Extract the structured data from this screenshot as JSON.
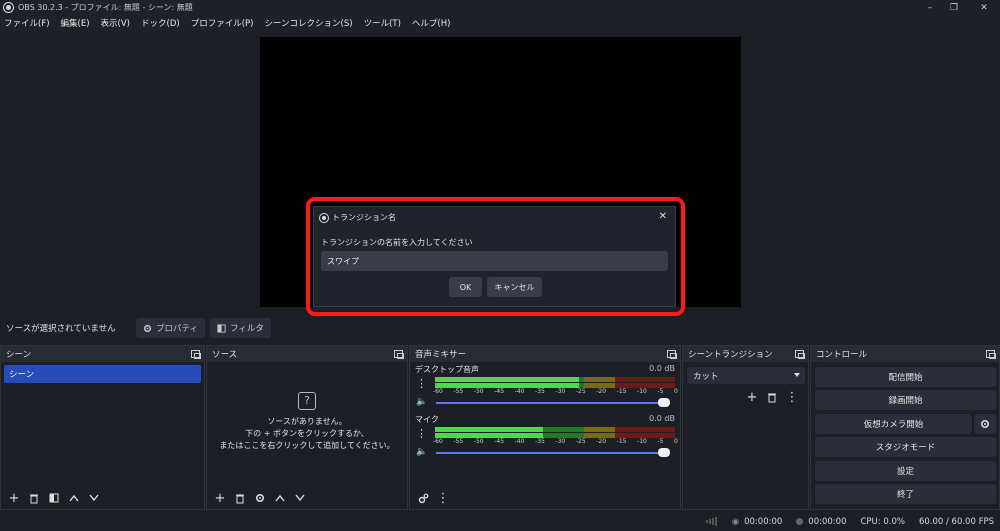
{
  "window": {
    "title": "OBS 30.2.3 - プロファイル: 無題 - シーン: 無題"
  },
  "menu": [
    "ファイル(F)",
    "編集(E)",
    "表示(V)",
    "ドック(D)",
    "プロファイル(P)",
    "シーンコレクション(S)",
    "ツール(T)",
    "ヘルプ(H)"
  ],
  "source_toolbar": {
    "no_source": "ソースが選択されていません",
    "properties": "プロパティ",
    "filters": "フィルタ"
  },
  "docks": {
    "scenes": {
      "title": "シーン",
      "items": [
        "シーン"
      ]
    },
    "sources": {
      "title": "ソース",
      "empty_line1": "ソースがありません。",
      "empty_line2": "下の + ボタンをクリックするか、",
      "empty_line3": "またはここを右クリックして追加してください。"
    },
    "mixer": {
      "title": "音声ミキサー",
      "channels": [
        {
          "name": "デスクトップ音声",
          "db": "0.0 dB",
          "level": 0.6
        },
        {
          "name": "マイク",
          "db": "0.0 dB",
          "level": 0.45
        }
      ],
      "scale": [
        "-60",
        "-55",
        "-50",
        "-45",
        "-40",
        "-35",
        "-30",
        "-25",
        "-20",
        "-15",
        "-10",
        "-5",
        "0"
      ]
    },
    "transitions": {
      "title": "シーントランジション",
      "selected": "カット"
    },
    "controls": {
      "title": "コントロール",
      "buttons": [
        "配信開始",
        "録画開始",
        "仮想カメラ開始",
        "スタジオモード",
        "設定",
        "終了"
      ]
    }
  },
  "status": {
    "time1": "00:00:00",
    "time2": "00:00:00",
    "cpu": "CPU: 0.0%",
    "fps": "60.00 / 60.00 FPS"
  },
  "dialog": {
    "title": "トランジション名",
    "prompt": "トランジションの名前を入力してください",
    "value": "スワイプ",
    "ok": "OK",
    "cancel": "キャンセル"
  }
}
